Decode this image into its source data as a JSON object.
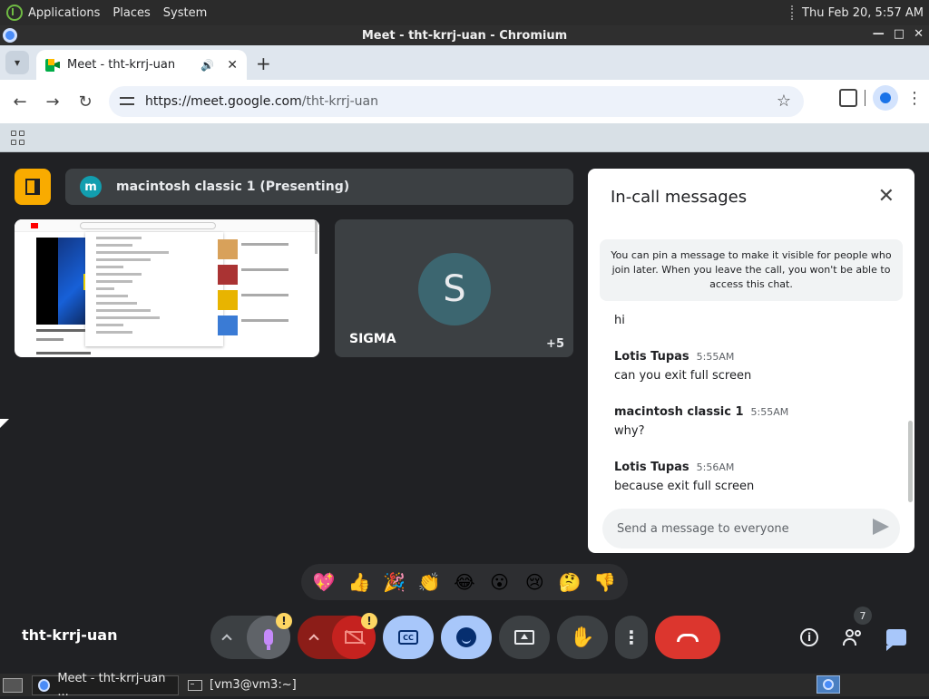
{
  "system": {
    "menus": [
      "Applications",
      "Places",
      "System"
    ],
    "clock": "Thu Feb 20,  5:57 AM"
  },
  "window": {
    "title": "Meet - tht-krrj-uan - Chromium",
    "controls": [
      "—",
      "□",
      "✕"
    ]
  },
  "browser": {
    "tab_title": "Meet - tht-krrj-uan",
    "url_host": "https://meet.google.com",
    "url_path": "/tht-krrj-uan"
  },
  "meet": {
    "presenting_avatar": "m",
    "presenting_label": "macintosh classic 1 (Presenting)",
    "participant": {
      "avatar_letter": "S",
      "name": "SIGMA",
      "more_count": "+5"
    },
    "meeting_code": "tht-krrj-uan",
    "people_count": "7",
    "warning_glyph": "!",
    "reactions": [
      "💖",
      "👍",
      "🎉",
      "👏",
      "😂",
      "😮",
      "😢",
      "🤔",
      "👎"
    ],
    "chat": {
      "title": "In-call messages",
      "pin_notice": "You can pin a message to make it visible for people who join later. When you leave the call, you won't be able to access this chat.",
      "messages": [
        {
          "sender": "",
          "time": "",
          "text": "hi"
        },
        {
          "sender": "Lotis Tupas",
          "time": "5:55AM",
          "text": "can you exit full screen"
        },
        {
          "sender": "macintosh classic 1",
          "time": "5:55AM",
          "text": "why?"
        },
        {
          "sender": "Lotis Tupas",
          "time": "5:56AM",
          "text": "because exit full screen"
        }
      ],
      "input_placeholder": "Send a message to everyone"
    }
  },
  "taskbar": {
    "items": [
      "Meet - tht-krrj-uan ...",
      "[vm3@vm3:~]"
    ]
  }
}
